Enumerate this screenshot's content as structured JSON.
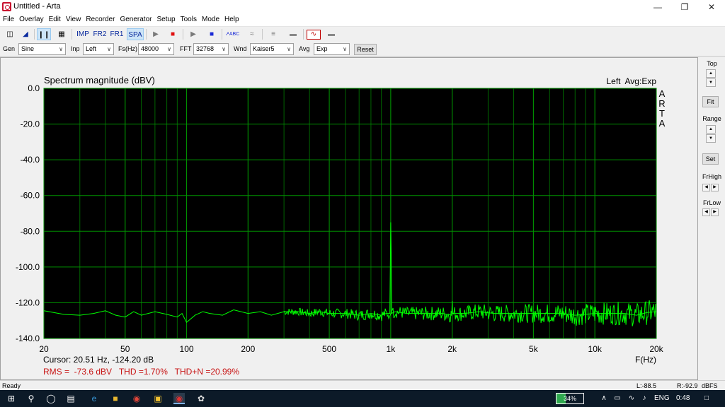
{
  "window": {
    "title": "Untitled - Arta"
  },
  "menu": [
    "File",
    "Overlay",
    "Edit",
    "View",
    "Recorder",
    "Generator",
    "Setup",
    "Tools",
    "Mode",
    "Help"
  ],
  "toolbar": {
    "imp": "IMP",
    "fr2": "FR2",
    "fr1": "FR1",
    "spa": "SPA"
  },
  "controls": {
    "gen_label": "Gen",
    "gen_value": "Sine",
    "inp_label": "Inp",
    "inp_value": "Left",
    "fs_label": "Fs(Hz)",
    "fs_value": "48000",
    "fft_label": "FFT",
    "fft_value": "32768",
    "wnd_label": "Wnd",
    "wnd_value": "Kaiser5",
    "avg_label": "Avg",
    "avg_value": "Exp",
    "reset_label": "Reset"
  },
  "graph": {
    "title": "Spectrum magnitude (dBV)",
    "info": "Left  Avg:Exp",
    "brand": [
      "A",
      "R",
      "T",
      "A"
    ],
    "x_axis_label": "F(Hz)",
    "cursor": "Cursor: 20.51 Hz, -124.20 dB",
    "stats": "RMS =  -73.6 dBV   THD =1.70%   THD+N =20.99%"
  },
  "chart_data": {
    "type": "line",
    "title": "Spectrum magnitude (dBV)",
    "xlabel": "F(Hz)",
    "ylabel": "",
    "x_scale": "log",
    "xlim": [
      20,
      20000
    ],
    "ylim": [
      -140,
      0
    ],
    "grid": true,
    "y_ticks": [
      0,
      -20,
      -40,
      -60,
      -80,
      -100,
      -120,
      -140
    ],
    "y_tick_labels": [
      "0.0",
      "-20.0",
      "-40.0",
      "-60.0",
      "-80.0",
      "-100.0",
      "-120.0",
      "-140.0"
    ],
    "x_ticks": [
      20,
      50,
      100,
      200,
      500,
      1000,
      2000,
      5000,
      10000,
      20000
    ],
    "x_tick_labels": [
      "20",
      "50",
      "100",
      "200",
      "500",
      "1k",
      "2k",
      "5k",
      "10k",
      "20k"
    ],
    "series": [
      {
        "color": "#00ff00",
        "x": [
          20,
          25,
          30,
          35,
          40,
          45,
          50,
          55,
          60,
          70,
          80,
          90,
          95,
          100,
          110,
          120,
          130,
          150,
          170,
          200,
          230,
          260,
          300,
          350,
          400,
          450,
          500,
          600,
          700,
          800,
          900,
          950,
          990,
          1000,
          1005,
          1010,
          1050,
          1200,
          1400,
          1600,
          1800,
          1990,
          2000,
          2010,
          2300,
          2700,
          3200,
          4000,
          5000,
          6000,
          7000,
          8000,
          10000,
          12000,
          14000,
          16000,
          18000,
          20000
        ],
        "y": [
          -124.5,
          -126.5,
          -127,
          -126,
          -124.5,
          -127,
          -128,
          -125,
          -127,
          -125,
          -126.5,
          -128,
          -126,
          -131,
          -127,
          -125,
          -126,
          -127,
          -124,
          -126,
          -125,
          -127,
          -125,
          -125,
          -126,
          -125,
          -126,
          -126,
          -127,
          -126,
          -127,
          -126,
          -126,
          -75,
          -92,
          -126,
          -125,
          -126,
          -126,
          -126,
          -126,
          -127,
          -119,
          -126,
          -126,
          -125,
          -126,
          -126,
          -126,
          -126,
          -126,
          -127,
          -126,
          -126,
          -126,
          -127,
          -125.5,
          -125
        ]
      }
    ]
  },
  "right_panel": {
    "top": "Top",
    "fit": "Fit",
    "range": "Range",
    "set": "Set",
    "frhigh": "FrHigh",
    "frlow": "FrLow"
  },
  "status": {
    "ready": "Ready",
    "l": "L:-88.5",
    "r": "R:-92.9",
    "unit": "dBFS"
  },
  "taskbar": {
    "battery": "34%",
    "lang": "ENG",
    "time": "0:48"
  }
}
